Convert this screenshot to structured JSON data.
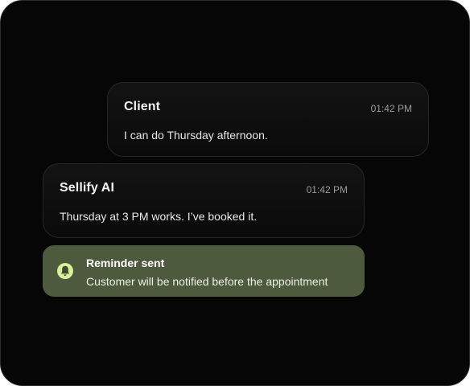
{
  "messages": [
    {
      "sender": "Client",
      "time": "01:42 PM",
      "text": "I can do Thursday afternoon."
    },
    {
      "sender": "Sellify AI",
      "time": "01:42 PM",
      "text": "Thursday at 3 PM works. I’ve booked it."
    }
  ],
  "notification": {
    "icon": "bell-icon",
    "title": "Reminder sent",
    "body": "Customer will be notified before the appointment"
  },
  "colors": {
    "background": "#060606",
    "bubble": "#131313",
    "toast": "#4d5a3e",
    "icon_accent": "#d8f09a"
  }
}
